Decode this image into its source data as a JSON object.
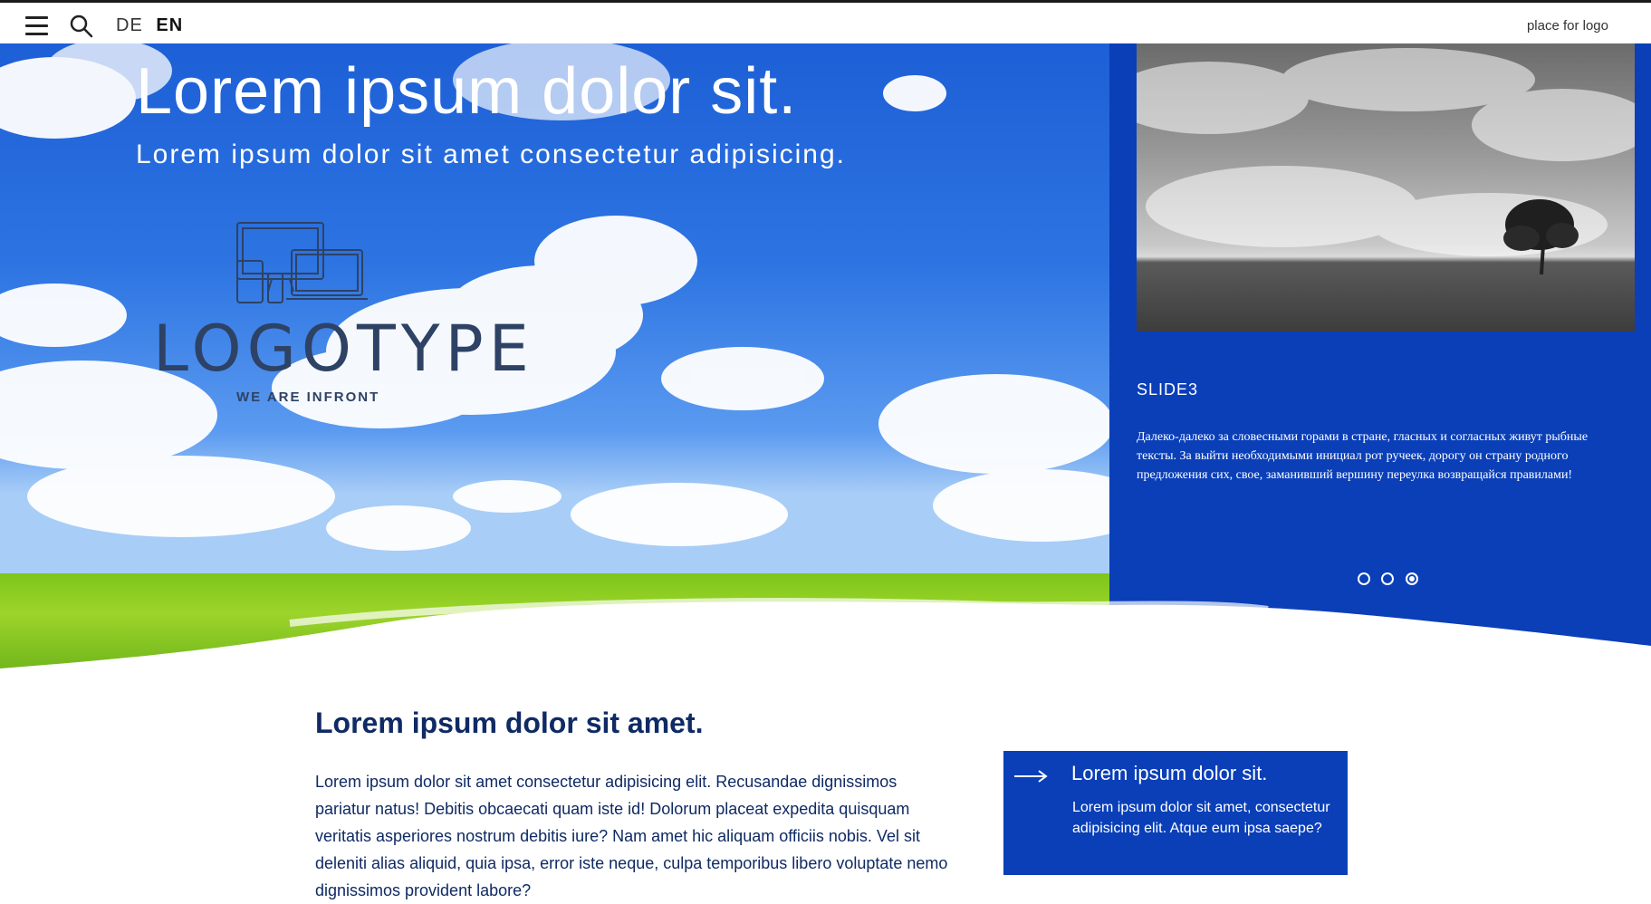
{
  "header": {
    "languages": [
      "DE",
      "EN"
    ],
    "active_language": "EN",
    "place_for_logo": "place for logo"
  },
  "hero": {
    "title": "Lorem ipsum dolor sit.",
    "subtitle": "Lorem ipsum dolor sit amet consectetur adipisicing.",
    "logo_text": "LOGOTYPE",
    "logo_tagline": "WE ARE INFRONT"
  },
  "slider": {
    "slide_title": "SLIDE3",
    "slide_text": "Далеко-далеко за словесными горами в стране, гласных и согласных живут рыбные тексты. За выйти необходимыми инициал рот ручеек, дорогу он страну родного предложения сих, свое, заманивший вершину переулка возвращайся правилами!",
    "active_slide": 3,
    "total_slides": 3
  },
  "content": {
    "title": "Lorem ipsum dolor sit amet.",
    "body": "Lorem ipsum dolor sit amet consectetur adipisicing elit. Recusandae dignissimos pariatur natus! Debitis obcaecati quam iste id! Dolorum placeat expedita quisquam veritatis asperiores nostrum debitis iure? Nam amet hic aliquam officiis nobis. Vel sit deleniti alias aliquid, quia ipsa, error iste neque, culpa temporibus libero voluptate nemo dignissimos provident labore?"
  },
  "cta": {
    "title": "Lorem ipsum dolor sit.",
    "text": "Lorem ipsum dolor sit amet, consectetur adipisicing elit. Atque eum ipsa saepe?"
  },
  "colors": {
    "brand_blue": "#0a3fb8",
    "heading_navy": "#0f2a64",
    "logo_slate": "#2e4265"
  },
  "icons": {
    "menu": "hamburger-menu-icon",
    "search": "search-icon",
    "arrow": "arrow-right-icon"
  }
}
